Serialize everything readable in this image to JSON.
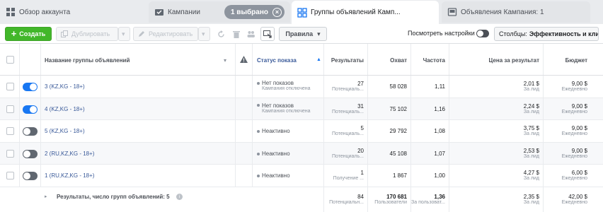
{
  "tabs": {
    "account": "Обзор аккаунта",
    "campaigns": "Кампании",
    "selected": "1 выбрано",
    "adsets": "Группы объявлений Камп...",
    "ads": "Объявления Кампания: 1"
  },
  "toolbar": {
    "create": "Создать",
    "duplicate": "Дублировать",
    "edit": "Редактировать",
    "rules": "Правила",
    "preview": "Посмотреть настройки",
    "columns_label": "Столбцы:",
    "columns_value": "Эффективность и клики"
  },
  "columns": {
    "name": "Название группы объявлений",
    "status": "Статус показа",
    "results": "Результаты",
    "reach": "Охват",
    "frequency": "Частота",
    "cost": "Цена за результат",
    "budget": "Бюджет"
  },
  "rows": [
    {
      "name": "3 (KZ,KG - 18+)",
      "on": true,
      "status": "Нет показов",
      "status_sub": "Кампания отключена",
      "results": "27",
      "results_sub": "Потенциаль...",
      "reach": "58 028",
      "freq": "1,11",
      "cost": "2,01 $",
      "cost_sub": "За лид",
      "budget": "9,00 $",
      "budget_sub": "Ежедневно"
    },
    {
      "name": "4 (KZ,KG - 18+)",
      "on": true,
      "status": "Нет показов",
      "status_sub": "Кампания отключена",
      "results": "31",
      "results_sub": "Потенциаль...",
      "reach": "75 102",
      "freq": "1,16",
      "cost": "2,24 $",
      "cost_sub": "За лид",
      "budget": "9,00 $",
      "budget_sub": "Ежедневно"
    },
    {
      "name": "5 (KZ,KG - 18+)",
      "on": false,
      "status": "Неактивно",
      "status_sub": "",
      "results": "5",
      "results_sub": "Потенциаль...",
      "reach": "29 792",
      "freq": "1,08",
      "cost": "3,75 $",
      "cost_sub": "За лид",
      "budget": "9,00 $",
      "budget_sub": "Ежедневно"
    },
    {
      "name": "2 (RU,KZ,KG - 18+)",
      "on": false,
      "status": "Неактивно",
      "status_sub": "",
      "results": "20",
      "results_sub": "Потенциаль...",
      "reach": "45 108",
      "freq": "1,07",
      "cost": "2,53 $",
      "cost_sub": "За лид",
      "budget": "9,00 $",
      "budget_sub": "Ежедневно"
    },
    {
      "name": "1 (RU,KZ,KG - 18+)",
      "on": false,
      "status": "Неактивно",
      "status_sub": "",
      "results": "1",
      "results_sub": "Получение ...",
      "reach": "1 867",
      "freq": "1,00",
      "cost": "4,27 $",
      "cost_sub": "За лид",
      "budget": "6,00 $",
      "budget_sub": "Ежедневно"
    }
  ],
  "totals": {
    "label": "Результаты, число групп объявлений: 5",
    "results": "84",
    "results_sub": "Потенциальн...",
    "reach": "170 681",
    "reach_sub": "Пользователи",
    "freq": "1,36",
    "freq_sub": "За пользоват...",
    "cost": "2,35 $",
    "cost_sub": "За лид",
    "budget": "42,00 $",
    "budget_sub": "Ежедневно"
  }
}
